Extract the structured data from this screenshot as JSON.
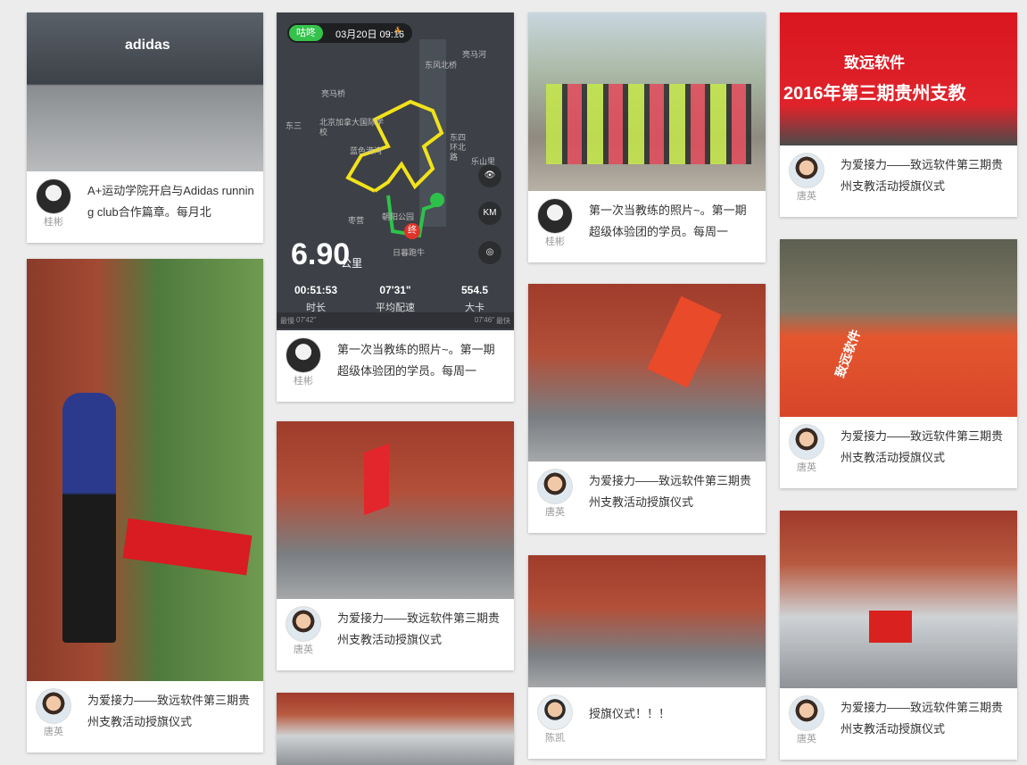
{
  "cards": [
    {
      "id": "c1",
      "user": "桂彬",
      "text": "A+运动学院开启与Adidas running club合作篇章。每月北"
    },
    {
      "id": "c2",
      "user": "桂彬",
      "text": "第一次当教练的照片~。第一期超级体验团的学员。每周一"
    },
    {
      "id": "c3",
      "user": "桂彬",
      "text": "第一次当教练的照片~。第一期超级体验团的学员。每周一"
    },
    {
      "id": "c4",
      "user": "唐英",
      "text": "为爱接力——致远软件第三期贵州支教活动授旗仪式"
    },
    {
      "id": "c5",
      "user": "唐英",
      "text": "为爱接力——致远软件第三期贵州支教活动授旗仪式"
    },
    {
      "id": "c6",
      "user": "唐英",
      "text": "为爱接力——致远软件第三期贵州支教活动授旗仪式"
    },
    {
      "id": "c7",
      "user": "唐英",
      "text": "为爱接力——致远软件第三期贵州支教活动授旗仪式"
    },
    {
      "id": "c8",
      "user": "陈凯",
      "text": "授旗仪式！！！"
    },
    {
      "id": "c9",
      "user": "唐英",
      "text": "为爱接力——致远软件第三期贵州支教活动授旗仪式"
    },
    {
      "id": "c10",
      "user": "唐英",
      "text": "为爱接力——致远软件第三期贵州支教活动授旗仪式"
    }
  ],
  "photo_texts": {
    "adidas_logo": "adidas",
    "flag_banner": "致远软件",
    "flag_banner_line2": "2016年第三期贵州支教",
    "flag_lower": "致远软件"
  },
  "run_map": {
    "app": "咕咚",
    "date": "03月20日 09:16",
    "distance": "6.90",
    "distance_unit": "公里",
    "duration": "00:51:53",
    "duration_label": "时长",
    "pace": "07'31\"",
    "pace_label": "平均配速",
    "calories": "554.5",
    "calories_label": "大卡",
    "slowest_label": "最慢",
    "slowest_val": "07'42\"",
    "fastest_label": "最快",
    "fastest_val": "07'46\"",
    "km_button": "KM",
    "end_marker": "终",
    "places": [
      "东风北桥",
      "亮马桥",
      "东四环北路",
      "北京加拿大国际学校",
      "亮马河",
      "朝阳公园",
      "蓝色港湾",
      "枣营",
      "日暮跑牛",
      "乐山里",
      "东三"
    ],
    "route_color": "#f2e21a",
    "route_color_2": "#2ec24b"
  }
}
